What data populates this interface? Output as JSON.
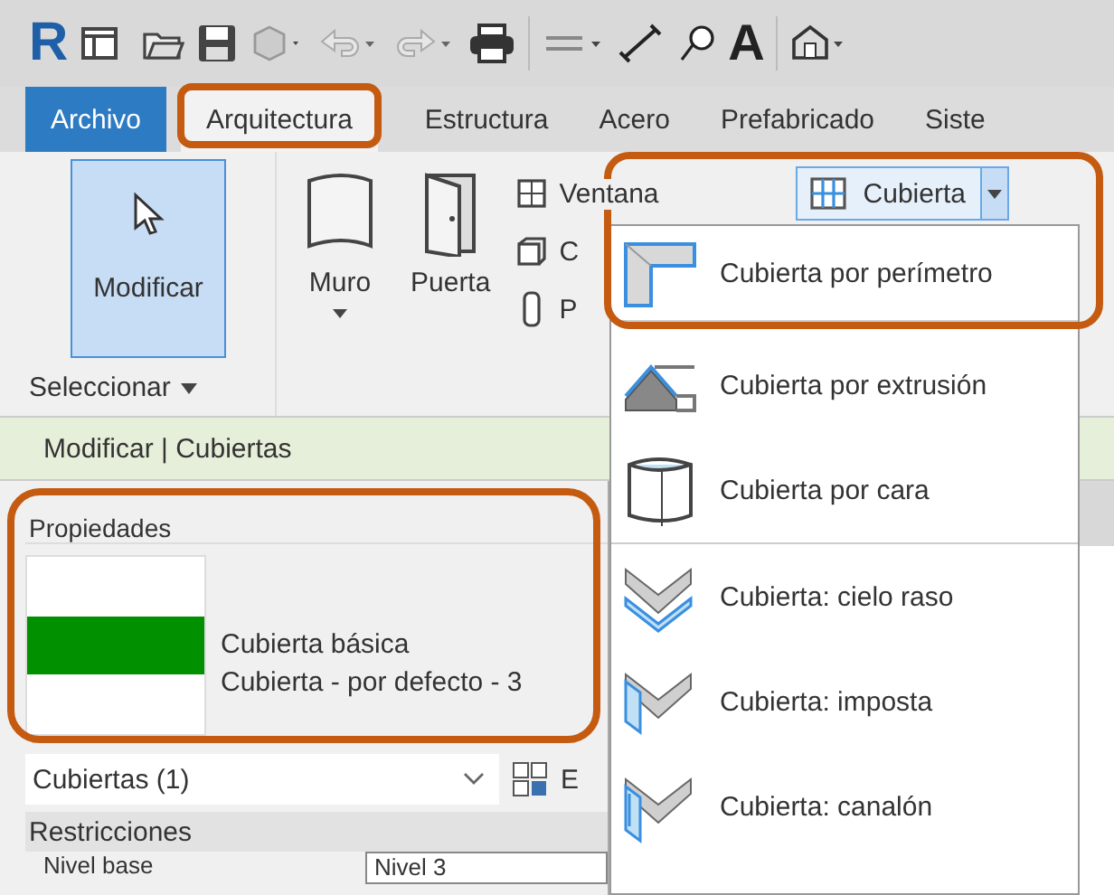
{
  "quick_access": {
    "logo": "R",
    "text_tool": "A"
  },
  "tabs": [
    {
      "label": "Archivo",
      "kind": "file",
      "selected": false
    },
    {
      "label": "Arquitectura",
      "kind": "tab",
      "selected": true
    },
    {
      "label": "Estructura",
      "kind": "tab",
      "selected": false
    },
    {
      "label": "Acero",
      "kind": "tab",
      "selected": false
    },
    {
      "label": "Prefabricado",
      "kind": "tab",
      "selected": false
    },
    {
      "label": "Siste",
      "kind": "tab",
      "selected": false
    }
  ],
  "ribbon": {
    "modify": {
      "label": "Modificar",
      "selected": true
    },
    "panel_label": "Seleccionar",
    "tools": [
      {
        "label": "Muro",
        "kind": "wall",
        "dropdown": true
      },
      {
        "label": "Puerta",
        "kind": "door",
        "dropdown": false
      }
    ],
    "small_tools": [
      {
        "label": "Ventana",
        "kind": "window"
      },
      {
        "label": "C",
        "kind": "component"
      },
      {
        "label": "P",
        "kind": "column"
      }
    ],
    "split_button": {
      "label": "Cubierta"
    }
  },
  "context_bar": "Modificar | Cubiertas",
  "dropdown": {
    "items": [
      {
        "label": "Cubierta por perímetro",
        "kind": "perimeter",
        "separator_after": true
      },
      {
        "label": "Cubierta por extrusión",
        "kind": "extrusion",
        "separator_after": false
      },
      {
        "label": "Cubierta por cara",
        "kind": "face",
        "separator_after": true
      },
      {
        "label": "Cubierta: cielo raso",
        "kind": "soffit",
        "separator_after": false
      },
      {
        "label": "Cubierta: imposta",
        "kind": "fascia",
        "separator_after": false
      },
      {
        "label": "Cubierta: canalón",
        "kind": "gutter",
        "separator_after": false
      }
    ]
  },
  "properties": {
    "title": "Propiedades",
    "type_family": "Cubierta básica",
    "type_name": "Cubierta - por defecto - 3",
    "selector": "Cubiertas (1)",
    "edit_type": "E",
    "sections": [
      {
        "title": "Restricciones",
        "rows": [
          {
            "name": "Nivel base",
            "value": "Nivel 3"
          }
        ]
      }
    ]
  }
}
